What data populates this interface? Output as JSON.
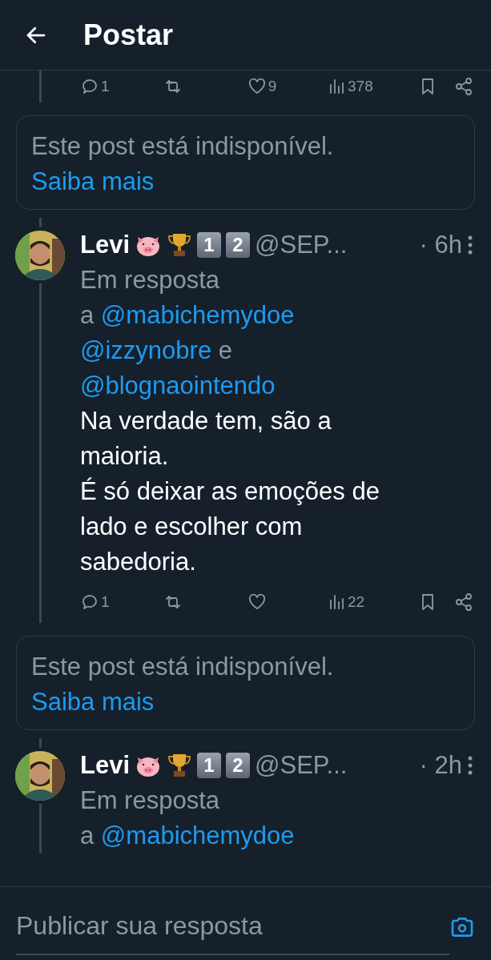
{
  "header": {
    "title": "Postar"
  },
  "thread": [
    {
      "kind": "tail",
      "actions": {
        "replies": "1",
        "likes": "9",
        "views": "378"
      }
    },
    {
      "kind": "unavailable",
      "text": "Este post está indisponível.",
      "link": "Saiba mais"
    },
    {
      "kind": "post",
      "name": "Levi",
      "badges": [
        "1",
        "2"
      ],
      "handle": "@SEP...",
      "time": "· 6h",
      "reply_to": {
        "label": "Em resposta",
        "connector": "a",
        "mentions": [
          "@mabichemydoe",
          "@izzynobre",
          "@blognaointendo"
        ],
        "joiner": "e"
      },
      "lines": [
        "Na verdade tem, são a maioria.",
        "É só deixar as emoções de lado e escolher com sabedoria."
      ],
      "actions": {
        "replies": "1",
        "views": "22"
      }
    },
    {
      "kind": "unavailable",
      "text": "Este post está indisponível.",
      "link": "Saiba mais"
    },
    {
      "kind": "post",
      "name": "Levi",
      "badges": [
        "1",
        "2"
      ],
      "handle": "@SEP...",
      "time": "· 2h",
      "reply_to": {
        "label": "Em resposta",
        "connector": "a",
        "mentions": [
          "@mabichemydoe"
        ]
      }
    }
  ],
  "composer": {
    "placeholder": "Publicar sua resposta"
  }
}
